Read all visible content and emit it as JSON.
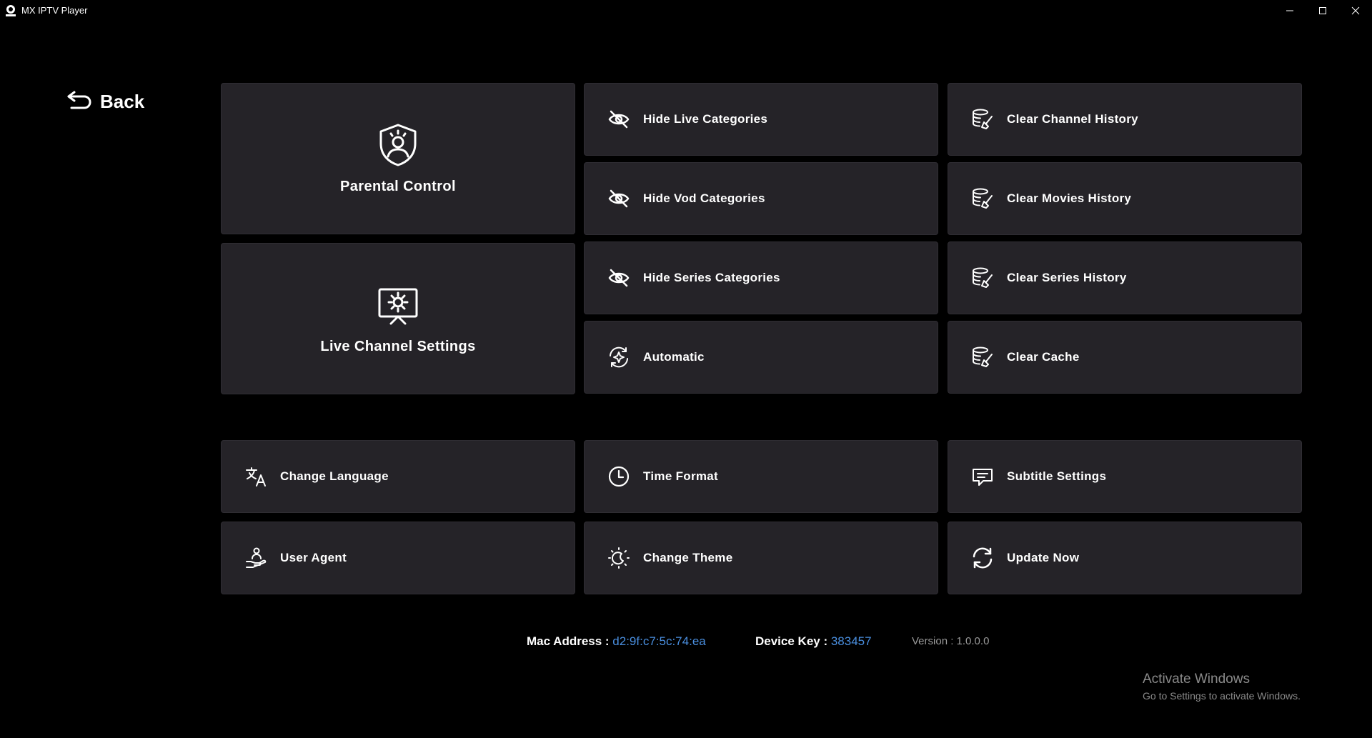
{
  "window": {
    "title": "MX IPTV Player",
    "minimize_icon": "minimize-icon",
    "maximize_icon": "maximize-icon",
    "close_icon": "close-icon"
  },
  "back": {
    "label": "Back",
    "icon": "back-arrow-icon"
  },
  "tiles": {
    "parental_control": {
      "label": "Parental Control",
      "icon": "shield-icon"
    },
    "live_channel_settings": {
      "label": "Live Channel Settings",
      "icon": "monitor-gear-icon"
    },
    "hide_live": {
      "label": "Hide Live Categories",
      "icon": "eye-off-icon"
    },
    "hide_vod": {
      "label": "Hide Vod Categories",
      "icon": "eye-off-icon"
    },
    "hide_series": {
      "label": "Hide Series Categories",
      "icon": "eye-off-icon"
    },
    "automatic": {
      "label": "Automatic",
      "icon": "sparkle-refresh-icon"
    },
    "clear_channel": {
      "label": "Clear Channel History",
      "icon": "database-broom-icon"
    },
    "clear_movies": {
      "label": "Clear Movies History",
      "icon": "database-broom-icon"
    },
    "clear_series": {
      "label": "Clear Series History",
      "icon": "database-broom-icon"
    },
    "clear_cache": {
      "label": "Clear Cache",
      "icon": "database-broom-icon"
    },
    "change_language": {
      "label": "Change Language",
      "icon": "translate-icon"
    },
    "time_format": {
      "label": "Time Format",
      "icon": "clock-icon"
    },
    "subtitle_settings": {
      "label": "Subtitle Settings",
      "icon": "message-icon"
    },
    "user_agent": {
      "label": "User Agent",
      "icon": "user-hand-icon"
    },
    "change_theme": {
      "label": "Change Theme",
      "icon": "moon-sun-icon"
    },
    "update_now": {
      "label": "Update Now",
      "icon": "refresh-icon"
    }
  },
  "footer": {
    "mac_label": "Mac Address : ",
    "mac_value": "d2:9f:c7:5c:74:ea",
    "device_key_label": "Device Key : ",
    "device_key_value": "383457",
    "version": "Version : 1.0.0.0"
  },
  "watermark": {
    "title": "Activate Windows",
    "subtitle": "Go to Settings to activate Windows."
  },
  "colors": {
    "background": "#000000",
    "tile": "#252328",
    "accent": "#4a8fe0"
  }
}
